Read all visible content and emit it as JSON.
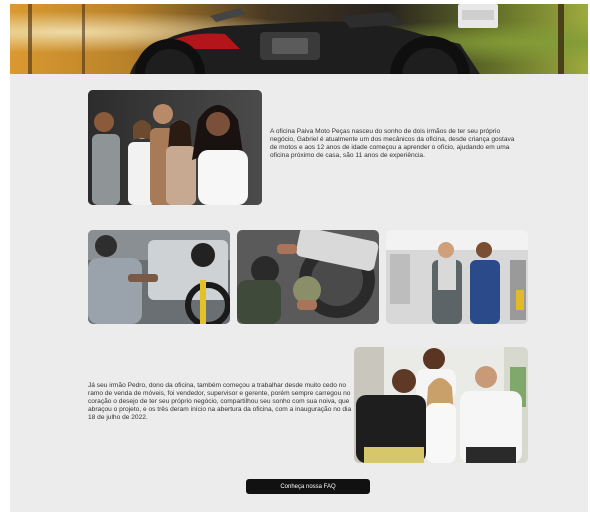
{
  "about": {
    "paragraph_1": "A oficina Paiva Moto Peças nasceu do sonho de dois irmãos de ter seu próprio negócio, Gabriel é atualmente um dos mecânicos da oficina, desde criança gostava de motos e aos 12 anos de idade começou a aprender o ofício, ajudando em uma oficina próximo de casa, são 11 anos de experiência.",
    "paragraph_2": "Já seu irmão Pedro, dono da oficina, também começou a trabalhar desde muito cedo no ramo de venda de móveis, foi vendedor, supervisor e gerente, porém sempre carregou no coração o desejo de ter seu próprio negócio, compartilhou seu sonho com sua noiva, que abraçou o projeto, e os três deram início na abertura da oficina, com a inauguração no dia 18 de julho de 2022."
  },
  "faq_button": {
    "label": "Conheça nossa FAQ"
  },
  "colors": {
    "page_bg": "#ececec",
    "button_bg": "#111111",
    "button_text": "#ffffff",
    "text": "#333333"
  }
}
